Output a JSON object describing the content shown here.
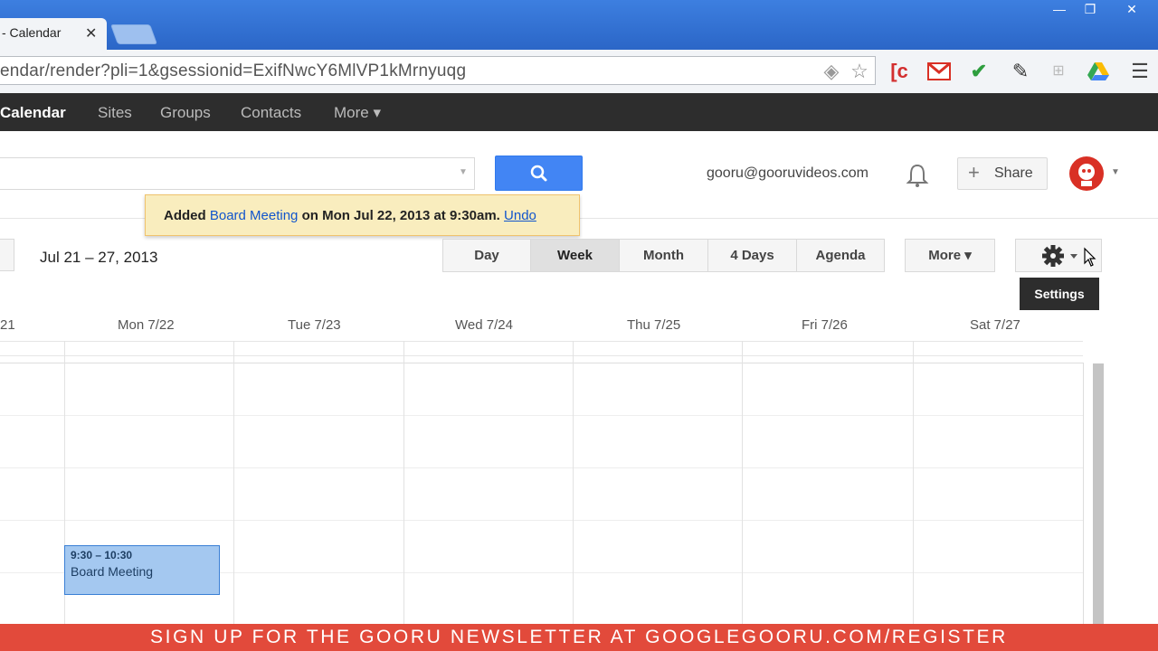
{
  "browser": {
    "tab_title": "- Calendar",
    "tab_close": "✕",
    "url": "endar/render?pli=1&gsessionid=ExifNwcY6MlVP1kMrnyuqg",
    "window_controls": {
      "minimize": "—",
      "maximize": "❐",
      "close": "✕"
    }
  },
  "google_bar": {
    "items": [
      {
        "label": "Calendar"
      },
      {
        "label": "Sites"
      },
      {
        "label": "Groups"
      },
      {
        "label": "Contacts"
      },
      {
        "label": "More ▾"
      }
    ]
  },
  "header": {
    "email": "gooru@gooruvideos.com",
    "share_label": "Share",
    "share_plus": "+"
  },
  "toast": {
    "prefix": "Added",
    "event_link": "Board Meeting",
    "suffix": "on Mon Jul 22, 2013 at 9:30am.",
    "undo": "Undo"
  },
  "controls": {
    "date_range": "Jul 21 – 27, 2013",
    "views": [
      "Day",
      "Week",
      "Month",
      "4 Days",
      "Agenda"
    ],
    "selected_view": "Week",
    "more": "More ▾",
    "settings_tooltip": "Settings"
  },
  "calendar": {
    "day_headers": [
      "21",
      "Mon 7/22",
      "Tue 7/23",
      "Wed 7/24",
      "Thu 7/25",
      "Fri 7/26",
      "Sat 7/27"
    ],
    "event": {
      "time": "9:30 – 10:30",
      "title": "Board Meeting"
    }
  },
  "banner": {
    "text": "SIGN UP FOR THE GOORU NEWSLETTER AT GOOGLEGOORU.COM/REGISTER"
  },
  "colors": {
    "accent_blue": "#4285f4",
    "toast_bg": "#f9edbe",
    "event_bg": "#a4c8f0",
    "banner_red": "#e24a3b",
    "google_bar": "#2d2d2d"
  }
}
